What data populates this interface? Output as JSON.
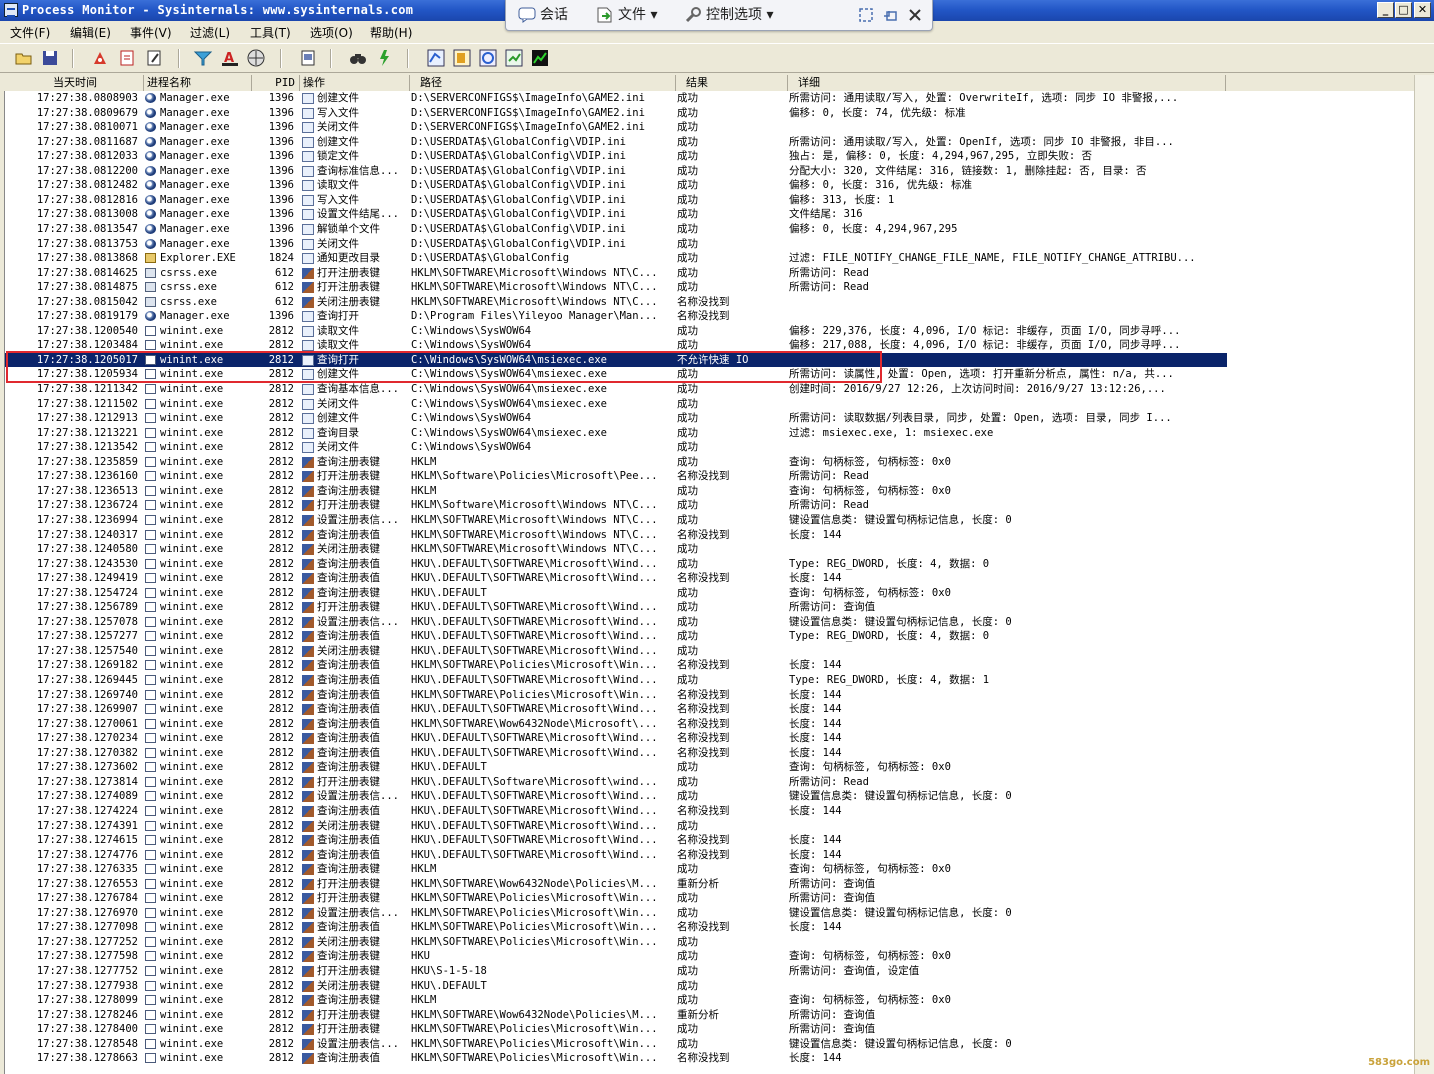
{
  "window": {
    "title": "Process Monitor - Sysinternals: www.sysinternals.com",
    "buttons": {
      "minimize": "_",
      "maximize": "□",
      "close": "✕"
    }
  },
  "floatbar": {
    "session": "会话",
    "file": "文件 ▾",
    "options": "控制选项 ▾"
  },
  "menu": [
    "文件(F)",
    "编辑(E)",
    "事件(V)",
    "过滤(L)",
    "工具(T)",
    "选项(O)",
    "帮助(H)"
  ],
  "columns": [
    "当天时间",
    "进程名称",
    "PID",
    "操作",
    "路径",
    "结果",
    "详细"
  ],
  "rows": [
    [
      "17:27:38.0808903",
      "Manager.exe",
      "1396",
      "创建文件",
      "D:\\SERVERCONFIGS$\\ImageInfo\\GAME2.ini",
      "成功",
      "所需访问: 通用读取/写入, 处置: OverwriteIf, 选项: 同步 IO 非警报,..."
    ],
    [
      "17:27:38.0809679",
      "Manager.exe",
      "1396",
      "写入文件",
      "D:\\SERVERCONFIGS$\\ImageInfo\\GAME2.ini",
      "成功",
      "偏移: 0, 长度: 74, 优先级: 标准"
    ],
    [
      "17:27:38.0810071",
      "Manager.exe",
      "1396",
      "关闭文件",
      "D:\\SERVERCONFIGS$\\ImageInfo\\GAME2.ini",
      "成功",
      ""
    ],
    [
      "17:27:38.0811687",
      "Manager.exe",
      "1396",
      "创建文件",
      "D:\\USERDATA$\\GlobalConfig\\VDIP.ini",
      "成功",
      "所需访问: 通用读取/写入, 处置: OpenIf, 选项: 同步 IO 非警报, 非目..."
    ],
    [
      "17:27:38.0812033",
      "Manager.exe",
      "1396",
      "锁定文件",
      "D:\\USERDATA$\\GlobalConfig\\VDIP.ini",
      "成功",
      "独占: 是, 偏移: 0, 长度: 4,294,967,295, 立即失败: 否"
    ],
    [
      "17:27:38.0812200",
      "Manager.exe",
      "1396",
      "查询标准信息...",
      "D:\\USERDATA$\\GlobalConfig\\VDIP.ini",
      "成功",
      "分配大小: 320, 文件结尾: 316, 链接数: 1, 删除挂起: 否, 目录: 否"
    ],
    [
      "17:27:38.0812482",
      "Manager.exe",
      "1396",
      "读取文件",
      "D:\\USERDATA$\\GlobalConfig\\VDIP.ini",
      "成功",
      "偏移: 0, 长度: 316, 优先级: 标准"
    ],
    [
      "17:27:38.0812816",
      "Manager.exe",
      "1396",
      "写入文件",
      "D:\\USERDATA$\\GlobalConfig\\VDIP.ini",
      "成功",
      "偏移: 313, 长度: 1"
    ],
    [
      "17:27:38.0813008",
      "Manager.exe",
      "1396",
      "设置文件结尾...",
      "D:\\USERDATA$\\GlobalConfig\\VDIP.ini",
      "成功",
      "文件结尾: 316"
    ],
    [
      "17:27:38.0813547",
      "Manager.exe",
      "1396",
      "解锁单个文件",
      "D:\\USERDATA$\\GlobalConfig\\VDIP.ini",
      "成功",
      "偏移: 0, 长度: 4,294,967,295"
    ],
    [
      "17:27:38.0813753",
      "Manager.exe",
      "1396",
      "关闭文件",
      "D:\\USERDATA$\\GlobalConfig\\VDIP.ini",
      "成功",
      ""
    ],
    [
      "17:27:38.0813868",
      "Explorer.EXE",
      "1824",
      "通知更改目录",
      "D:\\USERDATA$\\GlobalConfig",
      "成功",
      "过滤: FILE_NOTIFY_CHANGE_FILE_NAME, FILE_NOTIFY_CHANGE_ATTRIBU..."
    ],
    [
      "17:27:38.0814625",
      "csrss.exe",
      "612",
      "打开注册表键",
      "HKLM\\SOFTWARE\\Microsoft\\Windows NT\\C...",
      "成功",
      "所需访问: Read"
    ],
    [
      "17:27:38.0814875",
      "csrss.exe",
      "612",
      "打开注册表键",
      "HKLM\\SOFTWARE\\Microsoft\\Windows NT\\C...",
      "成功",
      "所需访问: Read"
    ],
    [
      "17:27:38.0815042",
      "csrss.exe",
      "612",
      "关闭注册表键",
      "HKLM\\SOFTWARE\\Microsoft\\Windows NT\\C...",
      "名称没找到",
      ""
    ],
    [
      "17:27:38.0819179",
      "Manager.exe",
      "1396",
      "查询打开",
      "D:\\Program Files\\Yileyoo Manager\\Man...",
      "名称没找到",
      ""
    ],
    [
      "17:27:38.1200540",
      "winint.exe",
      "2812",
      "读取文件",
      "C:\\Windows\\SysWOW64",
      "成功",
      "偏移: 229,376, 长度: 4,096, I/O 标记: 非缓存, 页面 I/O, 同步寻呼..."
    ],
    [
      "17:27:38.1203484",
      "winint.exe",
      "2812",
      "读取文件",
      "C:\\Windows\\SysWOW64",
      "成功",
      "偏移: 217,088, 长度: 4,096, I/O 标记: 非缓存, 页面 I/O, 同步寻呼..."
    ],
    [
      "17:27:38.1205017",
      "winint.exe",
      "2812",
      "查询打开",
      "C:\\Windows\\SysWOW64\\msiexec.exe",
      "不允许快速 IO",
      ""
    ],
    [
      "17:27:38.1205934",
      "winint.exe",
      "2812",
      "创建文件",
      "C:\\Windows\\SysWOW64\\msiexec.exe",
      "成功",
      "所需访问: 读属性, 处置: Open, 选项: 打开重新分析点, 属性: n/a, 共..."
    ],
    [
      "17:27:38.1211342",
      "winint.exe",
      "2812",
      "查询基本信息...",
      "C:\\Windows\\SysWOW64\\msiexec.exe",
      "成功",
      "创建时间: 2016/9/27 12:26, 上次访问时间: 2016/9/27 13:12:26,..."
    ],
    [
      "17:27:38.1211502",
      "winint.exe",
      "2812",
      "关闭文件",
      "C:\\Windows\\SysWOW64\\msiexec.exe",
      "成功",
      ""
    ],
    [
      "17:27:38.1212913",
      "winint.exe",
      "2812",
      "创建文件",
      "C:\\Windows\\SysWOW64",
      "成功",
      "所需访问: 读取数据/列表目录, 同步, 处置: Open, 选项: 目录, 同步 I..."
    ],
    [
      "17:27:38.1213221",
      "winint.exe",
      "2812",
      "查询目录",
      "C:\\Windows\\SysWOW64\\msiexec.exe",
      "成功",
      "过滤: msiexec.exe, 1: msiexec.exe"
    ],
    [
      "17:27:38.1213542",
      "winint.exe",
      "2812",
      "关闭文件",
      "C:\\Windows\\SysWOW64",
      "成功",
      ""
    ],
    [
      "17:27:38.1235859",
      "winint.exe",
      "2812",
      "查询注册表键",
      "HKLM",
      "成功",
      "查询: 句柄标签, 句柄标签: 0x0"
    ],
    [
      "17:27:38.1236160",
      "winint.exe",
      "2812",
      "打开注册表键",
      "HKLM\\Software\\Policies\\Microsoft\\Pee...",
      "名称没找到",
      "所需访问: Read"
    ],
    [
      "17:27:38.1236513",
      "winint.exe",
      "2812",
      "查询注册表键",
      "HKLM",
      "成功",
      "查询: 句柄标签, 句柄标签: 0x0"
    ],
    [
      "17:27:38.1236724",
      "winint.exe",
      "2812",
      "打开注册表键",
      "HKLM\\Software\\Microsoft\\Windows NT\\C...",
      "成功",
      "所需访问: Read"
    ],
    [
      "17:27:38.1236994",
      "winint.exe",
      "2812",
      "设置注册表信...",
      "HKLM\\SOFTWARE\\Microsoft\\Windows NT\\C...",
      "成功",
      "键设置信息类: 键设置句柄标记信息, 长度: 0"
    ],
    [
      "17:27:38.1240317",
      "winint.exe",
      "2812",
      "查询注册表值",
      "HKLM\\SOFTWARE\\Microsoft\\Windows NT\\C...",
      "名称没找到",
      "长度: 144"
    ],
    [
      "17:27:38.1240580",
      "winint.exe",
      "2812",
      "关闭注册表键",
      "HKLM\\SOFTWARE\\Microsoft\\Windows NT\\C...",
      "成功",
      ""
    ],
    [
      "17:27:38.1243530",
      "winint.exe",
      "2812",
      "查询注册表值",
      "HKU\\.DEFAULT\\SOFTWARE\\Microsoft\\Wind...",
      "成功",
      "Type: REG_DWORD, 长度: 4, 数据: 0"
    ],
    [
      "17:27:38.1249419",
      "winint.exe",
      "2812",
      "查询注册表值",
      "HKU\\.DEFAULT\\SOFTWARE\\Microsoft\\Wind...",
      "名称没找到",
      "长度: 144"
    ],
    [
      "17:27:38.1254724",
      "winint.exe",
      "2812",
      "查询注册表键",
      "HKU\\.DEFAULT",
      "成功",
      "查询: 句柄标签, 句柄标签: 0x0"
    ],
    [
      "17:27:38.1256789",
      "winint.exe",
      "2812",
      "打开注册表键",
      "HKU\\.DEFAULT\\SOFTWARE\\Microsoft\\Wind...",
      "成功",
      "所需访问: 查询值"
    ],
    [
      "17:27:38.1257078",
      "winint.exe",
      "2812",
      "设置注册表信...",
      "HKU\\.DEFAULT\\SOFTWARE\\Microsoft\\Wind...",
      "成功",
      "键设置信息类: 键设置句柄标记信息, 长度: 0"
    ],
    [
      "17:27:38.1257277",
      "winint.exe",
      "2812",
      "查询注册表值",
      "HKU\\.DEFAULT\\SOFTWARE\\Microsoft\\Wind...",
      "成功",
      "Type: REG_DWORD, 长度: 4, 数据: 0"
    ],
    [
      "17:27:38.1257540",
      "winint.exe",
      "2812",
      "关闭注册表键",
      "HKU\\.DEFAULT\\SOFTWARE\\Microsoft\\Wind...",
      "成功",
      ""
    ],
    [
      "17:27:38.1269182",
      "winint.exe",
      "2812",
      "查询注册表值",
      "HKLM\\SOFTWARE\\Policies\\Microsoft\\Win...",
      "名称没找到",
      "长度: 144"
    ],
    [
      "17:27:38.1269445",
      "winint.exe",
      "2812",
      "查询注册表值",
      "HKU\\.DEFAULT\\SOFTWARE\\Microsoft\\Wind...",
      "成功",
      "Type: REG_DWORD, 长度: 4, 数据: 1"
    ],
    [
      "17:27:38.1269740",
      "winint.exe",
      "2812",
      "查询注册表值",
      "HKLM\\SOFTWARE\\Policies\\Microsoft\\Win...",
      "名称没找到",
      "长度: 144"
    ],
    [
      "17:27:38.1269907",
      "winint.exe",
      "2812",
      "查询注册表值",
      "HKU\\.DEFAULT\\SOFTWARE\\Microsoft\\Wind...",
      "名称没找到",
      "长度: 144"
    ],
    [
      "17:27:38.1270061",
      "winint.exe",
      "2812",
      "查询注册表值",
      "HKLM\\SOFTWARE\\Wow6432Node\\Microsoft\\...",
      "名称没找到",
      "长度: 144"
    ],
    [
      "17:27:38.1270234",
      "winint.exe",
      "2812",
      "查询注册表值",
      "HKU\\.DEFAULT\\SOFTWARE\\Microsoft\\Wind...",
      "名称没找到",
      "长度: 144"
    ],
    [
      "17:27:38.1270382",
      "winint.exe",
      "2812",
      "查询注册表值",
      "HKU\\.DEFAULT\\SOFTWARE\\Microsoft\\Wind...",
      "名称没找到",
      "长度: 144"
    ],
    [
      "17:27:38.1273602",
      "winint.exe",
      "2812",
      "查询注册表键",
      "HKU\\.DEFAULT",
      "成功",
      "查询: 句柄标签, 句柄标签: 0x0"
    ],
    [
      "17:27:38.1273814",
      "winint.exe",
      "2812",
      "打开注册表键",
      "HKU\\.DEFAULT\\Software\\Microsoft\\wind...",
      "成功",
      "所需访问: Read"
    ],
    [
      "17:27:38.1274089",
      "winint.exe",
      "2812",
      "设置注册表信...",
      "HKU\\.DEFAULT\\SOFTWARE\\Microsoft\\Wind...",
      "成功",
      "键设置信息类: 键设置句柄标记信息, 长度: 0"
    ],
    [
      "17:27:38.1274224",
      "winint.exe",
      "2812",
      "查询注册表值",
      "HKU\\.DEFAULT\\SOFTWARE\\Microsoft\\Wind...",
      "名称没找到",
      "长度: 144"
    ],
    [
      "17:27:38.1274391",
      "winint.exe",
      "2812",
      "关闭注册表键",
      "HKU\\.DEFAULT\\SOFTWARE\\Microsoft\\Wind...",
      "成功",
      ""
    ],
    [
      "17:27:38.1274615",
      "winint.exe",
      "2812",
      "查询注册表值",
      "HKU\\.DEFAULT\\SOFTWARE\\Microsoft\\Wind...",
      "名称没找到",
      "长度: 144"
    ],
    [
      "17:27:38.1274776",
      "winint.exe",
      "2812",
      "查询注册表值",
      "HKU\\.DEFAULT\\SOFTWARE\\Microsoft\\Wind...",
      "名称没找到",
      "长度: 144"
    ],
    [
      "17:27:38.1276335",
      "winint.exe",
      "2812",
      "查询注册表键",
      "HKLM",
      "成功",
      "查询: 句柄标签, 句柄标签: 0x0"
    ],
    [
      "17:27:38.1276553",
      "winint.exe",
      "2812",
      "打开注册表键",
      "HKLM\\SOFTWARE\\Wow6432Node\\Policies\\M...",
      "重新分析",
      "所需访问: 查询值"
    ],
    [
      "17:27:38.1276784",
      "winint.exe",
      "2812",
      "打开注册表键",
      "HKLM\\SOFTWARE\\Policies\\Microsoft\\Win...",
      "成功",
      "所需访问: 查询值"
    ],
    [
      "17:27:38.1276970",
      "winint.exe",
      "2812",
      "设置注册表信...",
      "HKLM\\SOFTWARE\\Policies\\Microsoft\\Win...",
      "成功",
      "键设置信息类: 键设置句柄标记信息, 长度: 0"
    ],
    [
      "17:27:38.1277098",
      "winint.exe",
      "2812",
      "查询注册表值",
      "HKLM\\SOFTWARE\\Policies\\Microsoft\\Win...",
      "名称没找到",
      "长度: 144"
    ],
    [
      "17:27:38.1277252",
      "winint.exe",
      "2812",
      "关闭注册表键",
      "HKLM\\SOFTWARE\\Policies\\Microsoft\\Win...",
      "成功",
      ""
    ],
    [
      "17:27:38.1277598",
      "winint.exe",
      "2812",
      "查询注册表键",
      "HKU",
      "成功",
      "查询: 句柄标签, 句柄标签: 0x0"
    ],
    [
      "17:27:38.1277752",
      "winint.exe",
      "2812",
      "打开注册表键",
      "HKU\\S-1-5-18",
      "成功",
      "所需访问: 查询值, 设定值"
    ],
    [
      "17:27:38.1277938",
      "winint.exe",
      "2812",
      "关闭注册表键",
      "HKU\\.DEFAULT",
      "成功",
      ""
    ],
    [
      "17:27:38.1278099",
      "winint.exe",
      "2812",
      "查询注册表键",
      "HKLM",
      "成功",
      "查询: 句柄标签, 句柄标签: 0x0"
    ],
    [
      "17:27:38.1278246",
      "winint.exe",
      "2812",
      "打开注册表键",
      "HKLM\\SOFTWARE\\Wow6432Node\\Policies\\M...",
      "重新分析",
      "所需访问: 查询值"
    ],
    [
      "17:27:38.1278400",
      "winint.exe",
      "2812",
      "打开注册表键",
      "HKLM\\SOFTWARE\\Policies\\Microsoft\\Win...",
      "成功",
      "所需访问: 查询值"
    ],
    [
      "17:27:38.1278548",
      "winint.exe",
      "2812",
      "设置注册表信...",
      "HKLM\\SOFTWARE\\Policies\\Microsoft\\Win...",
      "成功",
      "键设置信息类: 键设置句柄标记信息, 长度: 0"
    ],
    [
      "17:27:38.1278663",
      "winint.exe",
      "2812",
      "查询注册表值",
      "HKLM\\SOFTWARE\\Policies\\Microsoft\\Win...",
      "名称没找到",
      "长度: 144"
    ]
  ],
  "selected_row": 18,
  "colors": {
    "selection": "#0a246a",
    "highlight_box": "#e0292f",
    "titlebar": "#2357c7"
  },
  "watermark": "583go.com"
}
